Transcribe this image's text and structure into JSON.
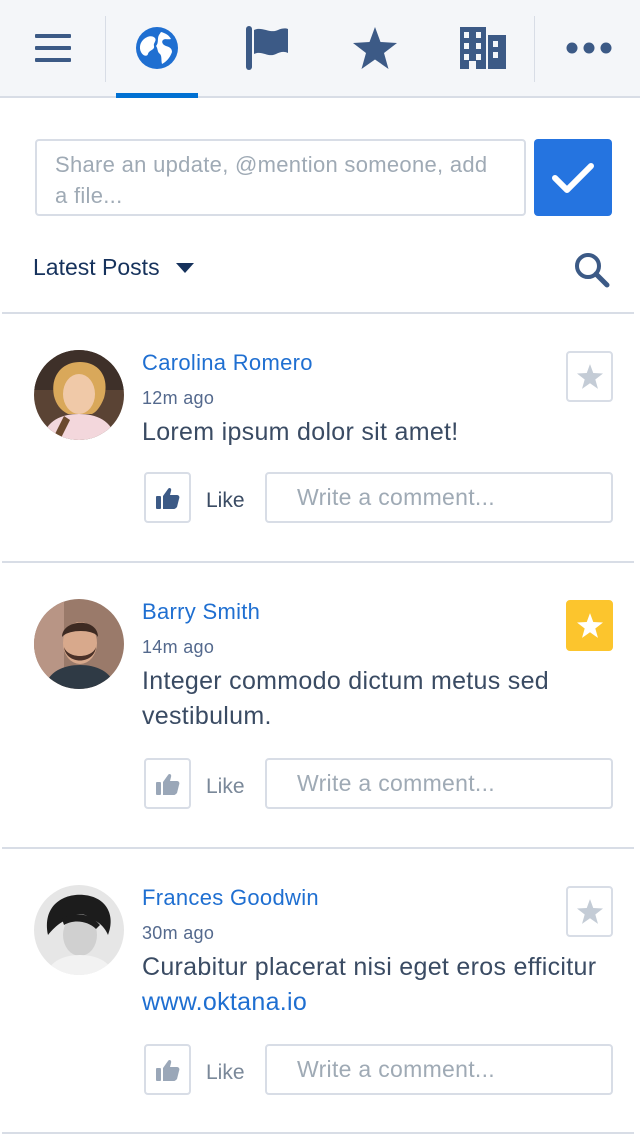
{
  "nav": {
    "items": [
      {
        "icon": "menu-icon"
      },
      {
        "icon": "globe-icon",
        "active": true
      },
      {
        "icon": "flag-icon"
      },
      {
        "icon": "star-icon"
      },
      {
        "icon": "building-icon"
      },
      {
        "icon": "more-icon"
      }
    ]
  },
  "publisher": {
    "placeholder": "Share an update, @mention someone, add a file..."
  },
  "feed": {
    "title": "Latest Posts"
  },
  "posts": [
    {
      "author": "Carolina Romero",
      "time": "12m ago",
      "body": "Lorem ipsum dolor sit amet!",
      "link": "",
      "favorited": false,
      "like_label": "Like",
      "comment_placeholder": "Write a comment..."
    },
    {
      "author": "Barry Smith",
      "time": "14m ago",
      "body": "Integer commodo dictum metus sed vestibulum.",
      "link": "",
      "favorited": true,
      "like_label": "Like",
      "comment_placeholder": "Write a comment..."
    },
    {
      "author": "Frances Goodwin",
      "time": "30m ago",
      "body": "Curabitur placerat nisi eget eros efficitur ",
      "link": "www.oktana.io",
      "favorited": false,
      "like_label": "Like",
      "comment_placeholder": "Write a comment..."
    }
  ],
  "colors": {
    "accent": "#2574e0",
    "nav_icon": "#3c5a86",
    "favorite": "#fcc52d",
    "link": "#1f6fd1"
  }
}
